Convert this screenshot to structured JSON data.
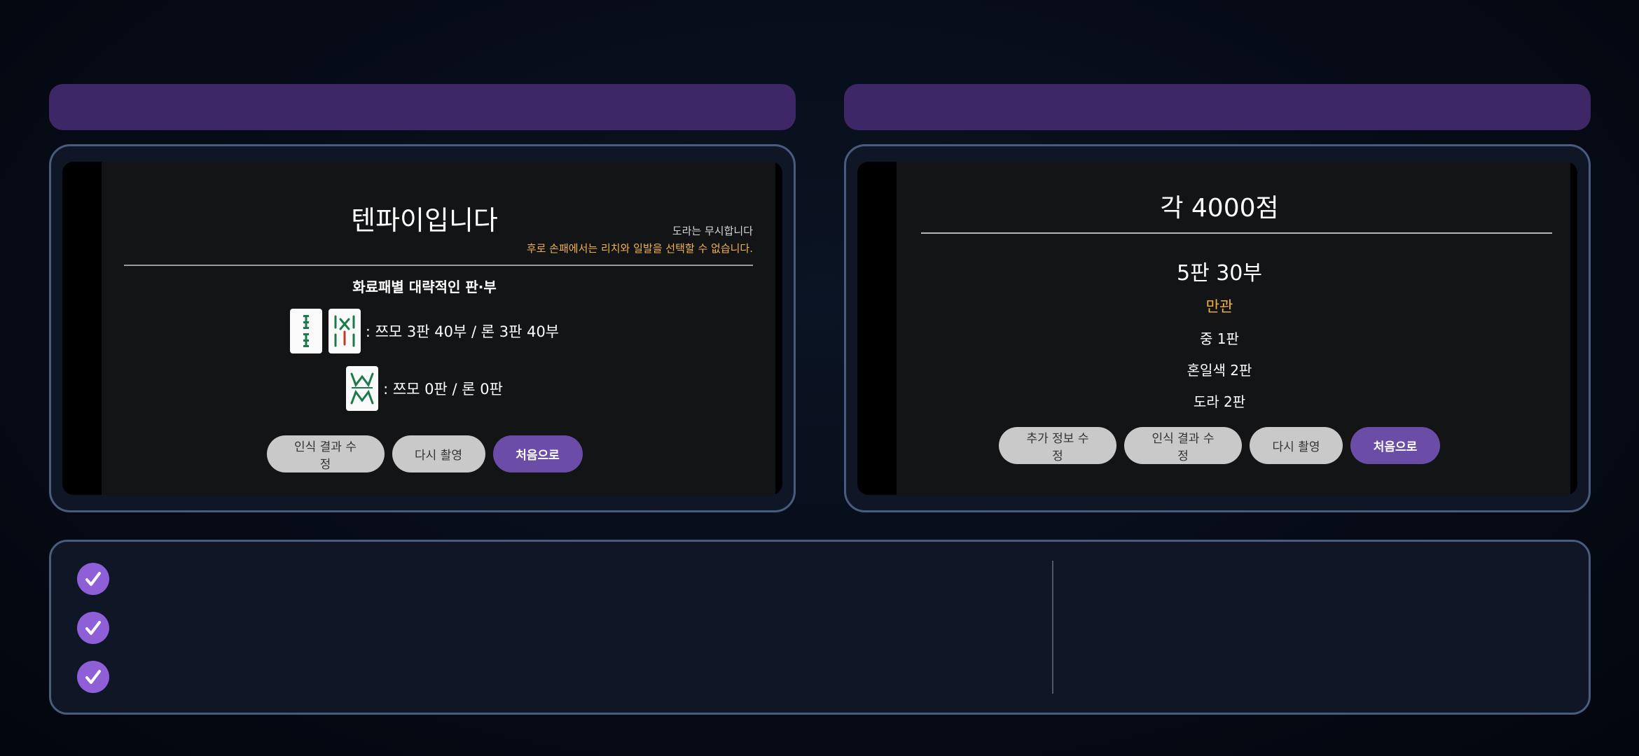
{
  "left_screen": {
    "title": "텐파이입니다",
    "faint_note": "",
    "dora_note": "도라는 무시합니다",
    "riichi_note": "후로 손패에서는 리치와 일발을 선택할 수 없습니다.",
    "section_title": "화료패별 대략적인 판·부",
    "waits": [
      {
        "tiles": [
          "2-bamboo",
          "8-bamboo"
        ],
        "text": ": 쯔모 3판 40부 / 론 3판 40부"
      },
      {
        "tiles": [
          "bamboo-special"
        ],
        "text": ": 쯔모 0판 / 론 0판"
      }
    ],
    "buttons": {
      "edit_recognition": "인식 결과 수정",
      "retake": "다시 촬영",
      "home": "처음으로"
    }
  },
  "right_screen": {
    "score": "각 4000점",
    "han_fu": "5판 30부",
    "limit": "만관",
    "yaku": [
      "중 1판",
      "혼일색 2판",
      "도라 2판"
    ],
    "buttons": {
      "edit_extra": "추가 정보 수정",
      "edit_recognition": "인식 결과 수정",
      "retake": "다시 촬영",
      "home": "처음으로"
    }
  },
  "features": {
    "check_count": 3
  },
  "colors": {
    "header_purple": "#3d2766",
    "panel_border": "#4a5c7e",
    "primary_button": "#6b4da8",
    "check_purple": "#8e5fd6",
    "warning_orange": "#f0b24c",
    "limit_gold": "#f3b43d"
  }
}
